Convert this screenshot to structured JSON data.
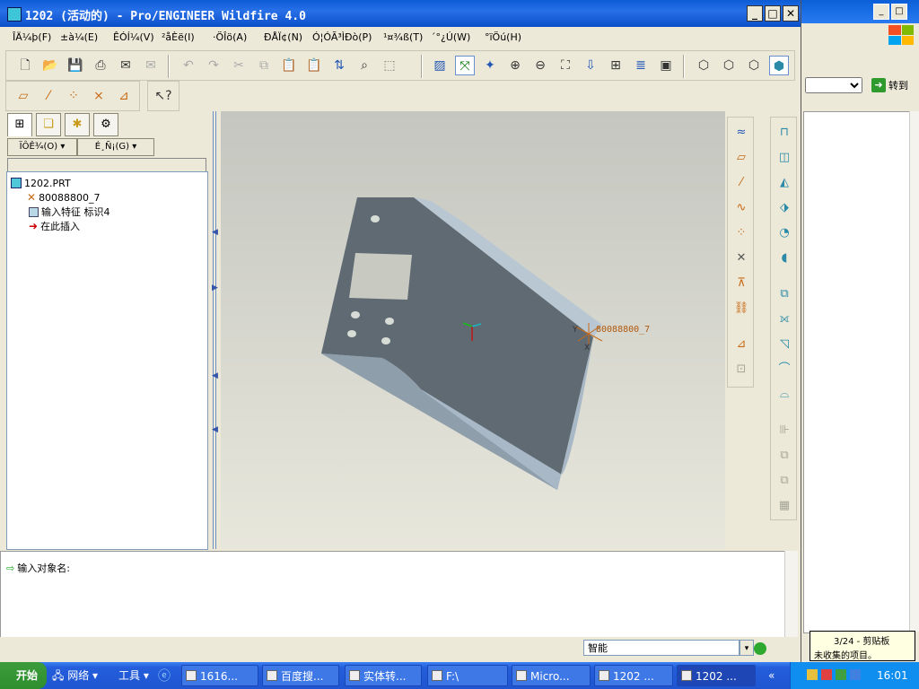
{
  "window": {
    "title": "1202 (活动的) - Pro/ENGINEER Wildfire 4.0",
    "min": "_",
    "max": "□",
    "close": "✕"
  },
  "menu": [
    "ÎÄ¼þ(F)",
    "±à¼­(E)",
    "ÊÓÍ¼(V)",
    "²åÈë(I)",
    "·ÖÎö(A)",
    "ÐÅÏ¢(N)",
    "Ó¦ÓÃ³ÌÐò(P)",
    "¹¤¾ß(T)",
    "´°¿Ú(W)",
    "°ïÖú(H)"
  ],
  "left_panel": {
    "dropdown1": "ÏÔÊ¾(O) ▾",
    "dropdown2": "É¸Ñ¡(G) ▾",
    "tree": [
      "1202.PRT",
      "80088800_7",
      "输入特征  标识4",
      "在此插入"
    ]
  },
  "viewport": {
    "csys_label": "80088800_7",
    "axis_x": "X",
    "axis_y": "Y"
  },
  "message": {
    "prompt": "输入对象名:"
  },
  "status": {
    "filter": "智能",
    "tooltip_line1": "3/24 - 剪贴板",
    "tooltip_line2": "未收集的项目。"
  },
  "bg_window": {
    "go_label": "转到",
    "min": "_",
    "max": "□"
  },
  "taskbar": {
    "start": "开始",
    "network": "网络",
    "tools": "工具",
    "tasks": [
      "1616...",
      "百度搜...",
      "实体转...",
      "F:\\",
      "Micro...",
      "1202 ...",
      "1202 ..."
    ],
    "clock": "16:01"
  },
  "colors": {
    "titlebar": "#0b5bd5",
    "model": "#5f6a73",
    "model_light": "#b9c7d3",
    "viewport_top": "#c4c6bf"
  }
}
